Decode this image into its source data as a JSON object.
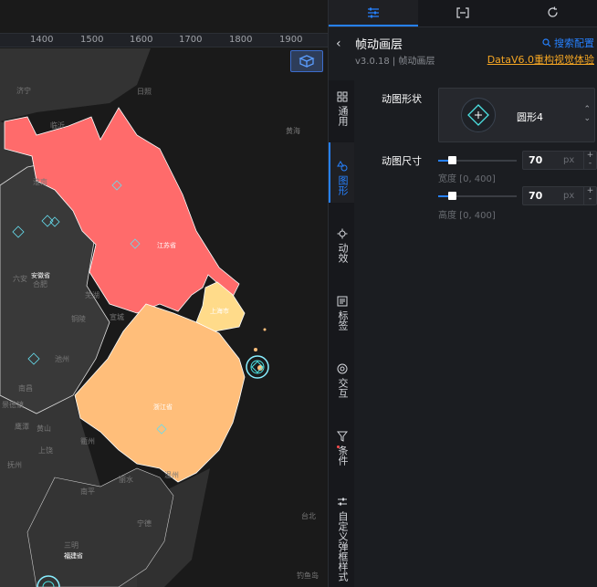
{
  "ruler": {
    "ticks": [
      "1400",
      "1500",
      "1600",
      "1700",
      "1800",
      "1900"
    ]
  },
  "map": {
    "provinces": {
      "jiangsu": "江苏省",
      "anhui": "安徽省",
      "shanghai": "上海市",
      "zhejiang": "浙江省",
      "fujian": "福建省"
    },
    "places": [
      "济宁",
      "临沂",
      "日照",
      "黄海",
      "合肥",
      "六安",
      "铜陵",
      "芜湖",
      "池州",
      "黄山",
      "衢州",
      "丽水",
      "温州",
      "台北",
      "南平",
      "宁德",
      "三明",
      "福州",
      "淮南",
      "宣城",
      "抚州",
      "鹰潭",
      "景德镇",
      "南昌",
      "上饶",
      "钓鱼岛"
    ],
    "colors": {
      "jiangsu": "#ff6b6b",
      "shanghai": "#ffdb8a",
      "zhejiang": "#ffbe7a",
      "land": "#3b3b3b",
      "sea": "#1a1a1a"
    }
  },
  "tabs": [
    {
      "icon": "sliders-icon",
      "active": true
    },
    {
      "icon": "bracket-icon",
      "active": false
    },
    {
      "icon": "refresh-icon",
      "active": false
    }
  ],
  "header": {
    "title": "帧动画层",
    "subtitle": "v3.0.18 | 帧动画层",
    "search_label": "搜索配置",
    "promo_label": "DataV6.0重构视觉体验"
  },
  "nav": [
    {
      "label": "通用",
      "icon": "grid-icon"
    },
    {
      "label": "图形",
      "icon": "shapes-icon",
      "active": true
    },
    {
      "label": "动效",
      "icon": "gear-icon"
    },
    {
      "label": "标签",
      "icon": "label-icon"
    },
    {
      "label": "交互",
      "icon": "interact-icon"
    },
    {
      "label": "条件",
      "icon": "filter-icon"
    },
    {
      "label": "自定义弹框样式",
      "icon": "custom-icon"
    }
  ],
  "config": {
    "shape_label": "动图形状",
    "shape_value": "圆形4",
    "size_label": "动图尺寸",
    "width": {
      "value": "70",
      "unit": "px",
      "hint": "宽度 [0, 400]",
      "fraction": 0.175
    },
    "height": {
      "value": "70",
      "unit": "px",
      "hint": "高度 [0, 400]",
      "fraction": 0.175
    }
  }
}
